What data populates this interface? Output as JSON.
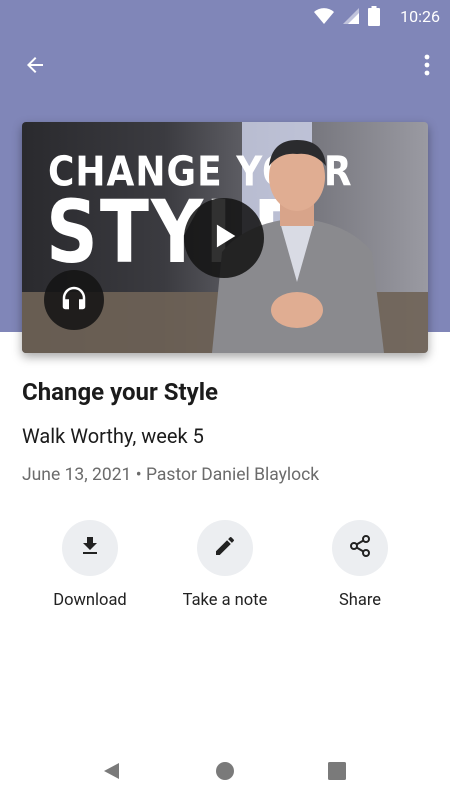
{
  "status_bar": {
    "time": "10:26",
    "icons": [
      "wifi-icon",
      "signal-icon",
      "battery-icon"
    ]
  },
  "toolbar": {
    "back_icon": "arrow-left-icon",
    "more_icon": "more-vert-icon"
  },
  "media": {
    "artwork_text_line1": "CHANGE YOUR",
    "artwork_text_line2": "STYLE",
    "play_icon": "play-icon",
    "audio_icon": "headphones-icon"
  },
  "sermon": {
    "title": "Change your Style",
    "series": "Walk Worthy, week 5",
    "meta": "June 13, 2021 • Pastor Daniel Blaylock"
  },
  "actions": [
    {
      "label": "Download",
      "icon": "download-icon"
    },
    {
      "label": "Take a note",
      "icon": "pencil-icon"
    },
    {
      "label": "Share",
      "icon": "share-icon"
    }
  ],
  "nav": {
    "icons": [
      "back-triangle-icon",
      "home-circle-icon",
      "recents-square-icon"
    ]
  },
  "colors": {
    "header": "#8086b8",
    "action_circle": "#eceef1",
    "meta_text": "#6b6b6b"
  }
}
